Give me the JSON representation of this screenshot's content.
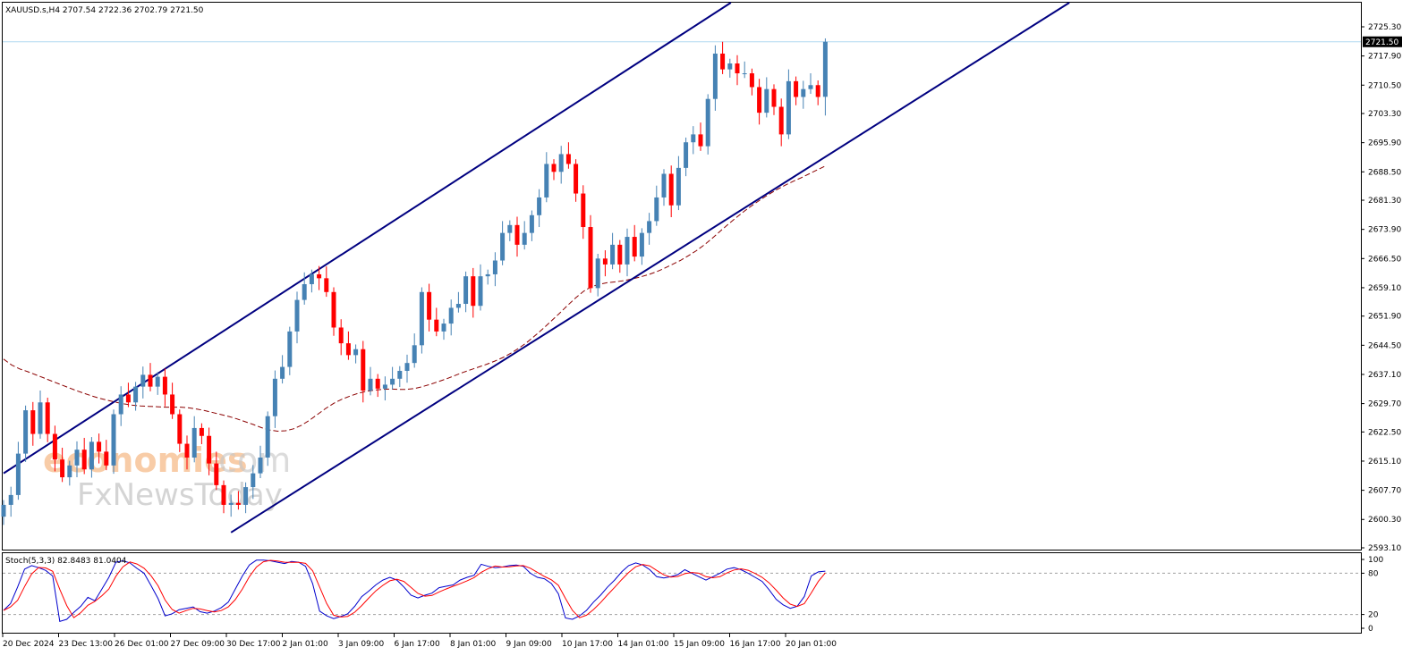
{
  "header": {
    "info": "XAUUSD.s,H4  2707.54 2722.36 2702.79 2721.50"
  },
  "watermark": {
    "part1": "economies",
    "part2": ".com",
    "part3": "FxNewsToday"
  },
  "price_axis": {
    "ticks": [
      "2725.30",
      "2717.90",
      "2710.50",
      "2703.30",
      "2695.90",
      "2688.50",
      "2681.30",
      "2673.90",
      "2666.50",
      "2659.10",
      "2651.90",
      "2644.50",
      "2637.10",
      "2629.70",
      "2622.50",
      "2615.10",
      "2607.70",
      "2600.30",
      "2593.10"
    ],
    "current_label": "2721.50"
  },
  "stoch": {
    "label": "Stoch(5,3,3) 82.8483 81.0404",
    "ticks": [
      "100",
      "80",
      "20",
      "0"
    ],
    "levels": [
      80,
      20
    ]
  },
  "time_axis": {
    "labels": [
      "20 Dec 2024",
      "23 Dec 13:00",
      "26 Dec 01:00",
      "27 Dec 09:00",
      "30 Dec 17:00",
      "2 Jan 01:00",
      "3 Jan 09:00",
      "6 Jan 17:00",
      "8 Jan 01:00",
      "9 Jan 09:00",
      "10 Jan 17:00",
      "14 Jan 01:00",
      "15 Jan 09:00",
      "16 Jan 17:00",
      "20 Jan 01:00"
    ]
  },
  "chart_data": {
    "type": "candlestick",
    "symbol": "XAUUSD.s",
    "timeframe": "H4",
    "last_ohlc": [
      2707.54,
      2722.36,
      2702.79,
      2721.5
    ],
    "y_range": [
      2593.1,
      2729.0
    ],
    "colors": {
      "bull": "#4682b4",
      "bear": "#ff0000",
      "channel": "#000080",
      "ma": "#8b0000",
      "stoch_main": "#0000cd",
      "stoch_signal": "#ff0000"
    },
    "closes": [
      2604.0,
      2606.5,
      2617.0,
      2628.0,
      2622.0,
      2630.0,
      2622.0,
      2615.5,
      2611.0,
      2614.0,
      2618.0,
      2613.0,
      2620.0,
      2617.5,
      2614.0,
      2627.0,
      2632.0,
      2630.0,
      2634.0,
      2637.0,
      2634.0,
      2636.5,
      2632.0,
      2627.0,
      2619.5,
      2616.0,
      2623.5,
      2621.5,
      2614.5,
      2609.0,
      2604.0,
      2604.5,
      2604.0,
      2608.5,
      2612.0,
      2616.0,
      2626.5,
      2636.0,
      2639.0,
      2648.0,
      2656.0,
      2660.0,
      2662.5,
      2661.5,
      2658.0,
      2649.0,
      2645.0,
      2642.0,
      2643.5,
      2633.0,
      2636.0,
      2633.5,
      2634.5,
      2636.0,
      2638.0,
      2640.0,
      2644.5,
      2658.0,
      2651.0,
      2648.0,
      2650.0,
      2654.0,
      2655.0,
      2662.0,
      2654.5,
      2662.0,
      2662.5,
      2666.0,
      2673.0,
      2675.0,
      2670.0,
      2673.0,
      2677.5,
      2682.0,
      2690.5,
      2688.5,
      2693.0,
      2690.5,
      2683.0,
      2674.5,
      2659.0,
      2666.5,
      2665.0,
      2670.0,
      2665.0,
      2672.0,
      2667.0,
      2673.0,
      2676.0,
      2682.0,
      2688.0,
      2680.0,
      2689.5,
      2696.0,
      2698.0,
      2695.0,
      2707.0,
      2718.5,
      2714.5,
      2716.0,
      2713.5,
      2713.5,
      2710.0,
      2703.5,
      2709.5,
      2705.0,
      2698.0,
      2711.5,
      2707.5,
      2709.5,
      2710.5,
      2707.5,
      2721.5
    ],
    "ma_values": [
      2641.0,
      2639.5,
      2638.5,
      2637.8,
      2637.0,
      2636.2,
      2635.4,
      2634.6,
      2633.8,
      2633.0,
      2632.3,
      2631.6,
      2631.0,
      2630.5,
      2630.0,
      2629.6,
      2629.3,
      2629.1,
      2629.0,
      2628.9,
      2628.8,
      2628.8,
      2628.8,
      2628.6,
      2628.3,
      2627.9,
      2627.4,
      2626.9,
      2626.4,
      2625.8,
      2625.1,
      2624.4,
      2623.6,
      2623.0,
      2622.7,
      2622.8,
      2623.3,
      2624.2,
      2625.5,
      2627.0,
      2628.5,
      2629.8,
      2630.8,
      2631.6,
      2632.3,
      2632.8,
      2633.1,
      2633.3,
      2633.4,
      2633.3,
      2633.3,
      2633.5,
      2634.0,
      2634.6,
      2635.3,
      2636.0,
      2636.8,
      2637.6,
      2638.3,
      2639.0,
      2639.7,
      2640.5,
      2641.4,
      2642.5,
      2643.8,
      2645.3,
      2647.0,
      2648.8,
      2650.7,
      2652.6,
      2654.6,
      2656.5,
      2658.2,
      2659.4,
      2660.0,
      2660.4,
      2660.6,
      2660.9,
      2661.3,
      2661.8,
      2662.4,
      2663.1,
      2664.0,
      2665.0,
      2666.0,
      2667.2,
      2668.5,
      2670.0,
      2671.7,
      2673.5,
      2675.3,
      2677.0,
      2678.6,
      2680.1,
      2681.5,
      2682.8,
      2684.0,
      2685.1,
      2686.1,
      2687.0,
      2688.0,
      2689.0,
      2690.0
    ],
    "channel": {
      "upper": {
        "from": {
          "index": 0,
          "price": 2612.0
        },
        "to": {
          "index": 105,
          "price": 2738.5
        }
      },
      "lower": {
        "from": {
          "index": 31,
          "price": 2597.0
        },
        "to": {
          "index": 150,
          "price": 2737.0
        }
      }
    },
    "stoch_main": [
      26,
      36,
      60,
      86,
      91,
      88,
      84,
      76,
      10,
      13,
      23,
      32,
      45,
      40,
      57,
      74,
      96,
      98,
      95,
      87,
      80,
      62,
      43,
      18,
      21,
      27,
      29,
      31,
      24,
      22,
      25,
      30,
      38,
      57,
      76,
      92,
      99,
      99,
      98,
      96,
      94,
      97,
      96,
      90,
      65,
      25,
      18,
      14,
      17,
      21,
      32,
      46,
      54,
      63,
      70,
      74,
      70,
      60,
      48,
      44,
      48,
      51,
      59,
      61,
      63,
      70,
      74,
      77,
      93,
      90,
      88,
      89,
      91,
      92,
      90,
      80,
      74,
      72,
      65,
      50,
      15,
      13,
      18,
      26,
      38,
      48,
      60,
      70,
      82,
      91,
      95,
      92,
      85,
      75,
      73,
      75,
      78,
      85,
      80,
      75,
      70,
      75,
      80,
      86,
      88,
      85,
      80,
      74,
      68,
      56,
      42,
      34,
      29,
      32,
      46,
      76,
      82,
      83
    ]
  }
}
